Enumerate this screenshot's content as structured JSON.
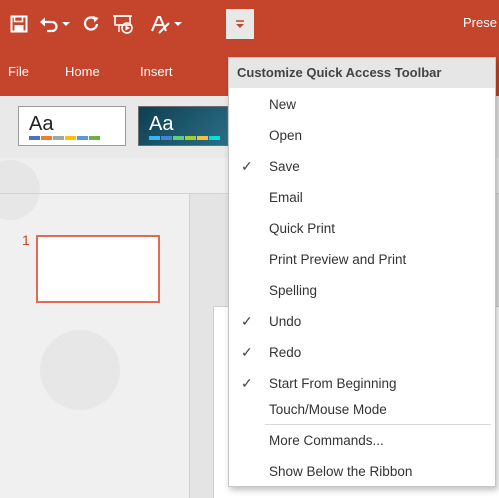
{
  "app": {
    "title": "Prese",
    "accent": "#c4452c"
  },
  "quick_access": {
    "icons": [
      "save-icon",
      "undo-icon",
      "dropdown-arrow-icon",
      "redo-icon",
      "start-from-beginning-icon",
      "touch-mouse-mode-icon",
      "customize-toolbar-icon"
    ]
  },
  "tabs": [
    {
      "label": "File"
    },
    {
      "label": "Home"
    },
    {
      "label": "Insert"
    }
  ],
  "themes": [
    {
      "label": "Aa",
      "style": "office-white"
    },
    {
      "label": "Aa",
      "style": "dark-teal"
    }
  ],
  "slides": {
    "items": [
      {
        "number": "1"
      }
    ]
  },
  "menu": {
    "header": "Customize Quick Access Toolbar",
    "items": [
      {
        "label": "New",
        "checked": false
      },
      {
        "label": "Open",
        "checked": false
      },
      {
        "label": "Save",
        "checked": true
      },
      {
        "label": "Email",
        "checked": false
      },
      {
        "label": "Quick Print",
        "checked": false
      },
      {
        "label": "Print Preview and Print",
        "checked": false
      },
      {
        "label": "Spelling",
        "checked": false
      },
      {
        "label": "Undo",
        "checked": true
      },
      {
        "label": "Redo",
        "checked": true
      },
      {
        "label": "Start From Beginning",
        "checked": true
      },
      {
        "label": "Touch/Mouse Mode",
        "checked": false
      }
    ],
    "more_commands": "More Commands...",
    "show_below": "Show Below the Ribbon",
    "check_glyph": "✓"
  }
}
